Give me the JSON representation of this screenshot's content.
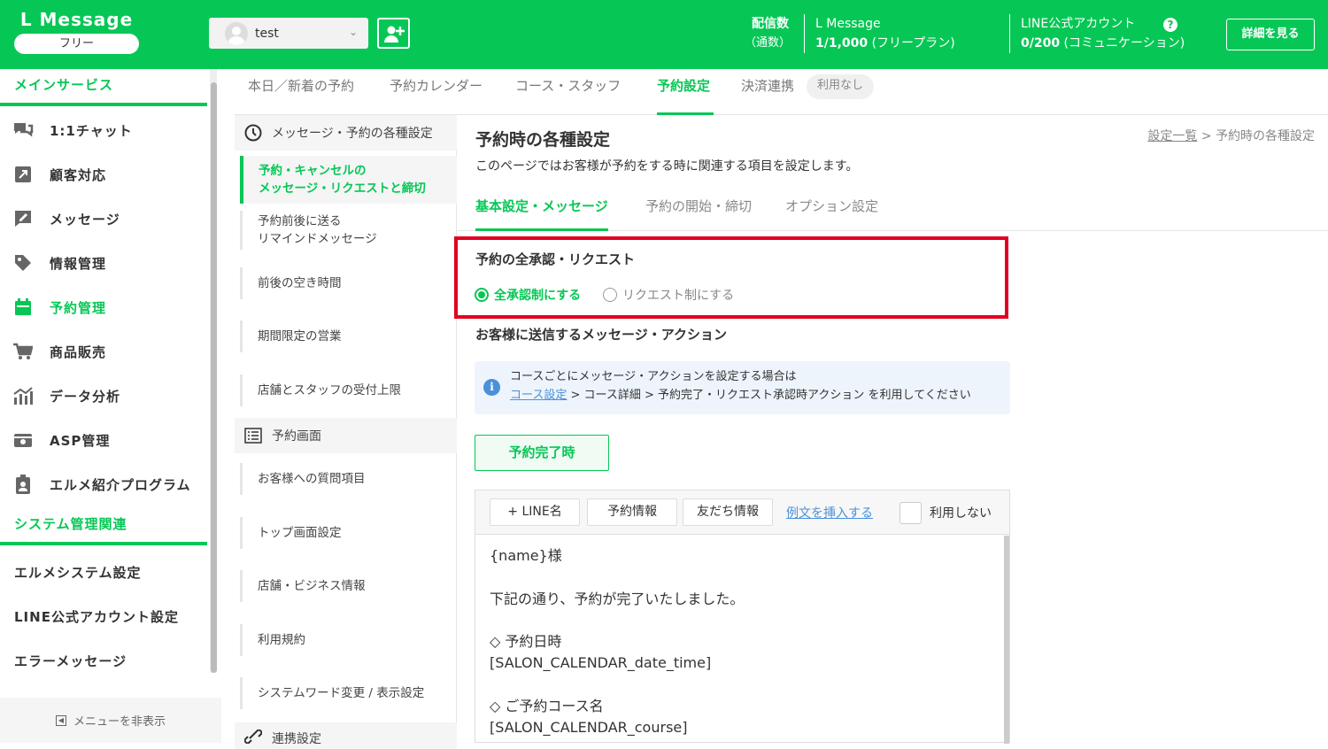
{
  "app": {
    "logo": "L Message",
    "plan_badge": "フリー"
  },
  "header": {
    "account_name": "test",
    "stats": [
      {
        "label": "配信数",
        "sub": "（通数）"
      },
      {
        "label": "L Message",
        "value": "1/1,000",
        "note": "(フリープラン)"
      },
      {
        "label": "LINE公式アカウント",
        "value": "0/200",
        "note": "(コミュニケーション)"
      }
    ],
    "help": "?",
    "details_button": "詳細を見る"
  },
  "sidebar": {
    "section_main": "メインサービス",
    "items": [
      {
        "label": "1:1チャット",
        "icon": "chat-icon"
      },
      {
        "label": "顧客対応",
        "icon": "customer-icon"
      },
      {
        "label": "メッセージ",
        "icon": "message-icon"
      },
      {
        "label": "情報管理",
        "icon": "tag-icon"
      },
      {
        "label": "予約管理",
        "icon": "calendar-icon"
      },
      {
        "label": "商品販売",
        "icon": "cart-icon"
      },
      {
        "label": "データ分析",
        "icon": "chart-icon"
      },
      {
        "label": "ASP管理",
        "icon": "asp-icon"
      },
      {
        "label": "エルメ紹介プログラム",
        "icon": "referral-icon"
      }
    ],
    "section_system": "システム管理関連",
    "system_items": [
      "エルメシステム設定",
      "LINE公式アカウント設定",
      "エラーメッセージ"
    ],
    "hide_menu": "メニューを非表示"
  },
  "tabs": [
    {
      "label": "本日／新着の予約"
    },
    {
      "label": "予約カレンダー"
    },
    {
      "label": "コース・スタッフ"
    },
    {
      "label": "予約設定"
    },
    {
      "label": "決済連携"
    }
  ],
  "tab_pill": "利用なし",
  "leftnav": {
    "head1": "メッセージ・予約の各種設定",
    "items1": [
      {
        "line1": "予約・キャンセルの",
        "line2": "メッセージ・リクエストと締切"
      },
      {
        "line1": "予約前後に送る",
        "line2": "リマインドメッセージ"
      },
      {
        "line1": "前後の空き時間",
        "line2": ""
      },
      {
        "line1": "期間限定の営業",
        "line2": ""
      },
      {
        "line1": "店舗とスタッフの受付上限",
        "line2": ""
      }
    ],
    "head2": "予約画面",
    "items2": [
      "お客様への質問項目",
      "トップ画面設定",
      "店舗・ビジネス情報",
      "利用規約",
      "システムワード変更 / 表示設定"
    ],
    "head3": "連携設定"
  },
  "content": {
    "title": "予約時の各種設定",
    "breadcrumb_link": "設定一覧",
    "breadcrumb_sep": ">",
    "breadcrumb_current": "予約時の各種設定",
    "description": "このページではお客様が予約をする時に関連する項目を設定します。",
    "subtabs": [
      "基本設定・メッセージ",
      "予約の開始・締切",
      "オプション設定"
    ],
    "approval": {
      "title": "予約の全承認・リクエスト",
      "option_on": "全承認制にする",
      "option_off": "リクエスト制にする"
    },
    "messages_title": "お客様に送信するメッセージ・アクション",
    "info_line1": "コースごとにメッセージ・アクションを設定する場合は",
    "info_link": "コース設定",
    "info_rest": " > コース詳細 > 予約完了・リクエスト承認時アクション を利用してください",
    "done_button": "予約完了時",
    "toolbar": {
      "line_name": "+ LINE名",
      "reservation_info": "予約情報",
      "friend_info": "友だち情報",
      "insert_example": "例文を挿入する",
      "disable": "利用しない"
    },
    "message_body": "{name}様\n\n下記の通り、予約が完了いたしました。\n\n◇ 予約日時\n[SALON_CALENDAR_date_time]\n\n◇ ご予約コース名\n[SALON_CALENDAR_course]"
  },
  "colors": {
    "brand": "#06c755",
    "highlight": "#e1001e",
    "link": "#4a90d9"
  }
}
